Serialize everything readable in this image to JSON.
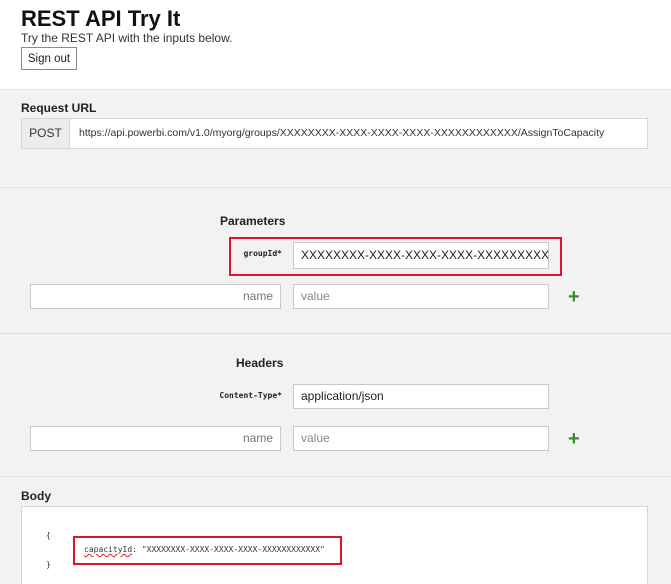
{
  "header": {
    "title": "REST API Try It",
    "subtitle": "Try the REST API with the inputs below.",
    "signout_label": "Sign out"
  },
  "request": {
    "label": "Request URL",
    "method": "POST",
    "url": "https://api.powerbi.com/v1.0/myorg/groups/XXXXXXXX-XXXX-XXXX-XXXX-XXXXXXXXXXXX/AssignToCapacity"
  },
  "parameters": {
    "label": "Parameters",
    "group_key": "groupId*",
    "group_value": "XXXXXXXX-XXXX-XXXX-XXXX-XXXXXXXXXXXX",
    "name_placeholder": "name",
    "value_placeholder": "value",
    "add_glyph": "+"
  },
  "headers": {
    "label": "Headers",
    "content_type_key": "Content-Type*",
    "content_type_value": "application/json",
    "name_placeholder": "name",
    "value_placeholder": "value",
    "add_glyph": "+"
  },
  "body": {
    "label": "Body",
    "open_brace": "{",
    "key": "capacityId",
    "separator": ": ",
    "value": "\"XXXXXXXX-XXXX-XXXX-XXXX-XXXXXXXXXXXX\"",
    "close_brace": "}"
  },
  "colors": {
    "highlight": "#e0112a",
    "add_icon": "#3a8a2e",
    "section_bg": "#f2f2f2"
  },
  "icons": {
    "add_parameter": "plus-icon",
    "add_header": "plus-icon"
  }
}
